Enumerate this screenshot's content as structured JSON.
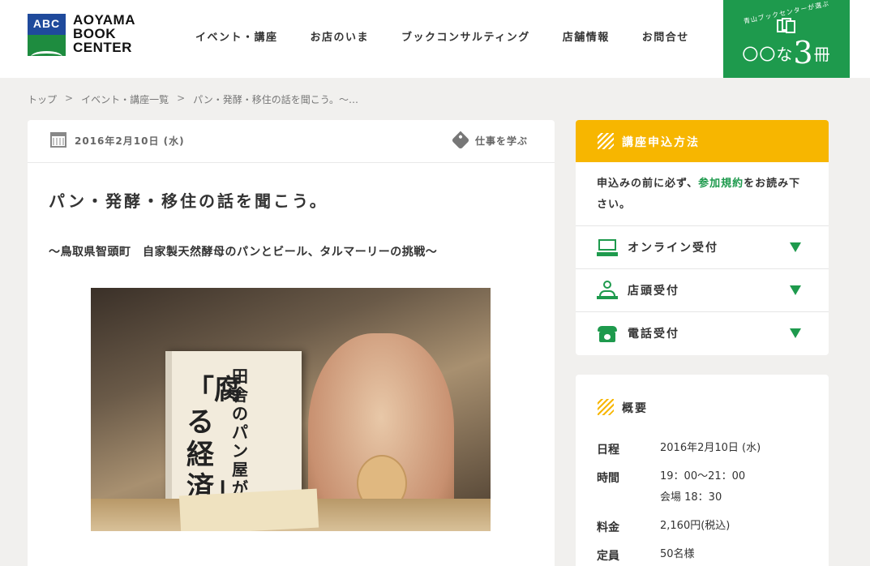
{
  "logo": {
    "mark": "ABC",
    "text_line1": "AOYAMA",
    "text_line2": "BOOK",
    "text_line3": "CENTER"
  },
  "nav": [
    "イベント・講座",
    "お店のいま",
    "ブックコンサルティング",
    "店舗情報",
    "お問合せ"
  ],
  "promo": {
    "small": "青山ブックセンターが選ぶ",
    "prefix": "〇〇な",
    "number": "3",
    "suffix": "冊"
  },
  "breadcrumb": [
    "トップ",
    "イベント・講座一覧",
    "パン・発酵・移住の話を聞こう。〜…"
  ],
  "breadcrumb_sep": ">",
  "event": {
    "date": "2016年2月10日 (水)",
    "category": "仕事を学ぶ",
    "title": "パン・発酵・移住の話を聞こう。",
    "subtitle": "〜鳥取県智頭町　自家製天然酵母のパンとビール、タルマーリーの挑戦〜",
    "photo_book_title": "「腐る経済」",
    "photo_book_sub": "田舎のパン屋が見つけた"
  },
  "apply": {
    "title": "講座申込方法",
    "note_before": "申込みの前に必ず、",
    "note_link": "参加規約",
    "note_after": "をお読み下さい。",
    "options": [
      {
        "label": "オンライン受付",
        "icon": "computer-icon"
      },
      {
        "label": "店頭受付",
        "icon": "shop-clerk-icon"
      },
      {
        "label": "電話受付",
        "icon": "telephone-icon"
      }
    ]
  },
  "summary": {
    "title": "概要",
    "rows": [
      {
        "label": "日程",
        "value": "2016年2月10日 (水)",
        "value2": ""
      },
      {
        "label": "時間",
        "value": "19：00〜21：00",
        "value2": "会場 18：30"
      },
      {
        "label": "料金",
        "value": "2,160円(税込)",
        "value2": ""
      },
      {
        "label": "定員",
        "value": "50名様",
        "value2": ""
      }
    ]
  },
  "colors": {
    "brand_green": "#1e9a4d",
    "accent_yellow": "#f7b600",
    "logo_blue": "#1f4a9c"
  }
}
